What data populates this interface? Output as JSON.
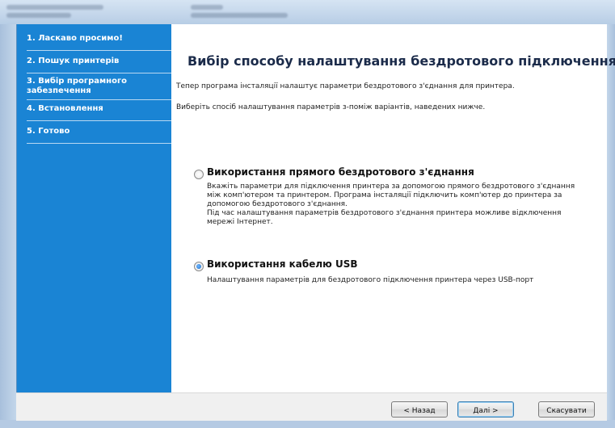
{
  "window": {
    "title": ""
  },
  "sidebar": {
    "items": [
      {
        "label": "1. Ласкаво просимо!"
      },
      {
        "label": "2. Пошук принтерів"
      },
      {
        "label": "3. Вибір програмного забезпечення"
      },
      {
        "label": "4. Встановлення"
      },
      {
        "label": "5. Готово"
      }
    ]
  },
  "main": {
    "title": "Вибір способу налаштування бездротового підключення",
    "intro1": "Тепер програма інсталяції налаштує параметри бездротового з'єднання для принтера.",
    "intro2": "Виберіть спосіб налаштування параметрів з-поміж варіантів, наведених нижче.",
    "options": [
      {
        "label": "Використання прямого бездротового з'єднання",
        "selected": false,
        "desc": [
          "Вкажіть параметри для підключення принтера за допомогою прямого бездротового з'єднання",
          "між комп'ютером та принтером. Програма інсталяції підключить комп'ютер до принтера за",
          "допомогою бездротового з'єднання.",
          "Під час налаштування параметрів бездротового з'єднання принтера можливе відключення",
          "мережі Інтернет."
        ]
      },
      {
        "label": "Використання кабелю USB",
        "selected": true,
        "desc": [
          "Налаштування параметрів для бездротового підключення принтера через USB-порт"
        ]
      }
    ]
  },
  "footer": {
    "back_label": "< Назад",
    "next_label": "Далі >",
    "cancel_label": "Скасувати"
  },
  "colors": {
    "sidebar_bg": "#1a84d4",
    "title_text": "#1b2b4a",
    "radio_selected": "#1f6fc6"
  }
}
